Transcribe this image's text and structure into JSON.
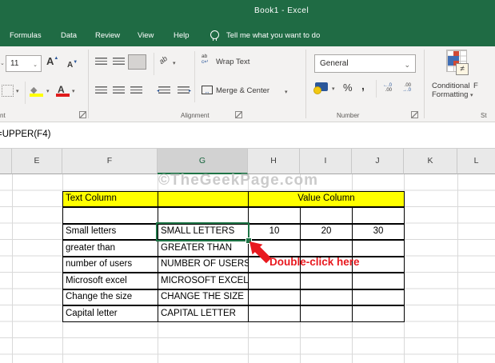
{
  "colors": {
    "excel_green": "#1f6b44",
    "selection_green": "#1e7446",
    "highlight_yellow": "#ffff00",
    "annotation_red": "#e8191f",
    "watermark_gray": "#c6c6c6"
  },
  "titlebar": {
    "title": "Book1 - Excel"
  },
  "tab_bar": {
    "tabs": [
      "Formulas",
      "Data",
      "Review",
      "View",
      "Help"
    ],
    "tell_me": "Tell me what you want to do"
  },
  "ribbon": {
    "font": {
      "size_value": "11",
      "grow_font_glyph": "A",
      "shrink_font_glyph": "A",
      "font_color_glyph": "A",
      "group_label": "nt"
    },
    "alignment": {
      "orientation_glyph": "ab",
      "wrap_icon_glyph": "ab",
      "wrap_text_label": "Wrap Text",
      "merge_center_label": "Merge & Center",
      "group_label": "Alignment"
    },
    "number": {
      "format_value": "General",
      "percent_glyph": "%",
      "comma_glyph": ",",
      "inc_decimal_top": "←.0",
      "inc_decimal_bottom": ".00",
      "dec_decimal_top": ".00",
      "dec_decimal_bottom": "→.0",
      "group_label": "Number"
    },
    "styles": {
      "conditional_line1": "Conditional",
      "conditional_line2": "Formatting",
      "neq_glyph": "≠",
      "next_button_partial": "F",
      "group_label": "St"
    }
  },
  "formula_bar": {
    "value": "=UPPER(F4)"
  },
  "sheet": {
    "column_headers": [
      "E",
      "F",
      "G",
      "H",
      "I",
      "J",
      "K",
      "L"
    ],
    "selected_column": "G",
    "table": {
      "text_col_header": "Text Column",
      "value_col_header": "Value Column",
      "rows": [
        {
          "text": "Small letters",
          "upper": "SMALL LETTERS",
          "v1": "10",
          "v2": "20",
          "v3": "30"
        },
        {
          "text": "greater than",
          "upper": "GREATER THAN"
        },
        {
          "text": "number of users",
          "upper": "NUMBER OF USERS"
        },
        {
          "text": "Microsoft excel",
          "upper": "MICROSOFT EXCEL"
        },
        {
          "text": "Change the size",
          "upper": "CHANGE THE SIZE"
        },
        {
          "text": "Capital letter",
          "upper": "CAPITAL LETTER"
        }
      ]
    }
  },
  "annotation": {
    "label": "Double-click here"
  },
  "watermark": {
    "text": "©TheGeekPage.com"
  }
}
